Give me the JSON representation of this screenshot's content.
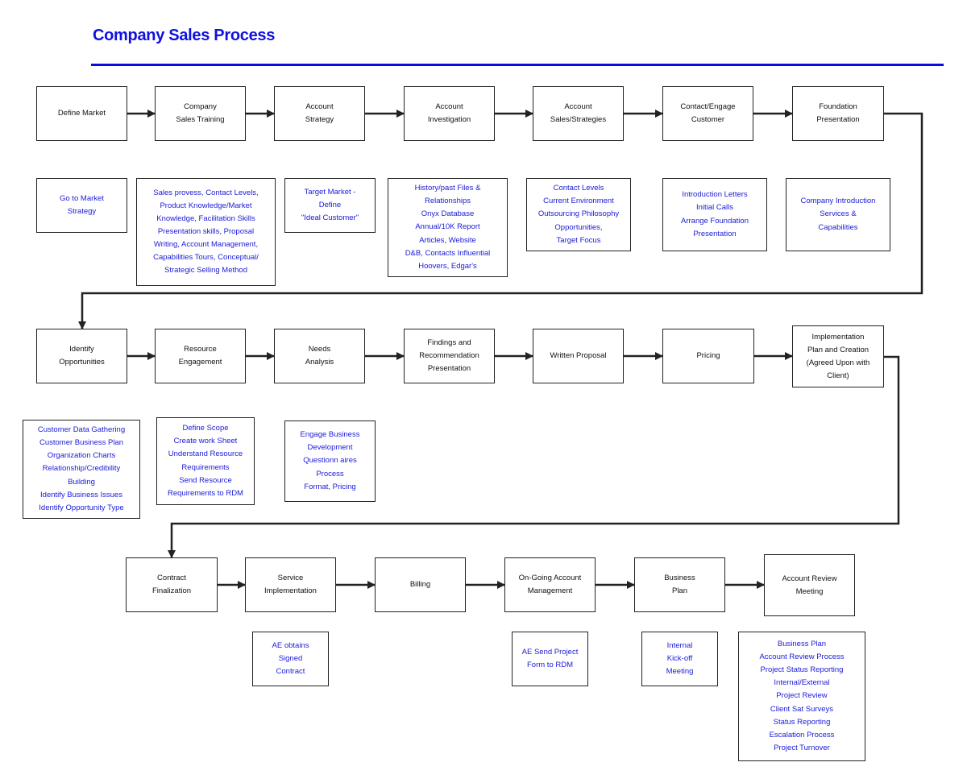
{
  "title": "Company Sales Process",
  "colors": {
    "title": "#1010e0",
    "note_text": "#1a1ad8",
    "step_text": "#111111",
    "connector": "#222222"
  },
  "row1": {
    "steps": [
      {
        "id": "define-market",
        "label": "Define Market"
      },
      {
        "id": "company-sales-training",
        "label": "Company\nSales Training"
      },
      {
        "id": "account-strategy",
        "label": "Account\nStrategy"
      },
      {
        "id": "account-investigation",
        "label": "Account\nInvestigation"
      },
      {
        "id": "account-sales-strategies",
        "label": "Account\nSales/Strategies"
      },
      {
        "id": "contact-engage-customer",
        "label": "Contact/Engage\nCustomer"
      },
      {
        "id": "foundation-presentation",
        "label": "Foundation\nPresentation"
      }
    ],
    "notes": [
      {
        "for": "define-market",
        "text": "Go to Market\nStrategy"
      },
      {
        "for": "company-sales-training",
        "text": "Sales provess, Contact Levels,\nProduct Knowledge/Market\nKnowledge, Facilitation Skills\nPresentation skills, Proposal\nWriting, Account Management,\nCapabilities Tours, Conceptual/\nStrategic Selling Method"
      },
      {
        "for": "account-strategy",
        "text": "Target Market -\nDefine\n\"Ideal Customer\""
      },
      {
        "for": "account-investigation",
        "text": "History/past Files &\nRelationships\nOnyx Database\nAnnual/10K Report\nArticles, Website\nD&B, Contacts Influential\nHoovers, Edgar's"
      },
      {
        "for": "account-sales-strategies",
        "text": "Contact Levels\nCurrent Environment\nOutsourcing Philosophy\nOpportunities,\nTarget Focus"
      },
      {
        "for": "contact-engage-customer",
        "text": "Introduction Letters\nInitial Calls\nArrange Foundation\nPresentation"
      },
      {
        "for": "foundation-presentation",
        "text": "Company Introduction\nServices &\nCapabilities"
      }
    ]
  },
  "row2": {
    "steps": [
      {
        "id": "identify-opportunities",
        "label": "Identify\nOpportunities"
      },
      {
        "id": "resource-engagement",
        "label": "Resource\nEngagement"
      },
      {
        "id": "needs-analysis",
        "label": "Needs\nAnalysis"
      },
      {
        "id": "findings-recommendation",
        "label": "Findings and\nRecommendation\nPresentation"
      },
      {
        "id": "written-proposal",
        "label": "Written Proposal"
      },
      {
        "id": "pricing",
        "label": "Pricing"
      },
      {
        "id": "implementation-plan",
        "label": "Implementation\nPlan and Creation\n(Agreed Upon with\nClient)"
      }
    ],
    "notes": [
      {
        "for": "identify-opportunities",
        "text": "Customer Data Gathering\nCustomer Business Plan\nOrganization Charts\nRelationship/Credibility\nBuilding\nIdentify Business Issues\nIdentify Opportunity Type"
      },
      {
        "for": "resource-engagement",
        "text": "Define Scope\nCreate work Sheet\nUnderstand Resource\nRequirements\nSend Resource\nRequirements to RDM"
      },
      {
        "for": "needs-analysis",
        "text": "Engage Business\nDevelopment\nQuestionn aires\nProcess\nFormat, Pricing"
      }
    ]
  },
  "row3": {
    "steps": [
      {
        "id": "contract-finalization",
        "label": "Contract\nFinalization"
      },
      {
        "id": "service-implementation",
        "label": "Service\nImplementation"
      },
      {
        "id": "billing",
        "label": "Billing"
      },
      {
        "id": "ongoing-account-management",
        "label": "On-Going Account\nManagement"
      },
      {
        "id": "business-plan",
        "label": "Business\nPlan"
      },
      {
        "id": "account-review-meeting",
        "label": "Account Review\nMeeting"
      }
    ],
    "notes": [
      {
        "for": "service-implementation",
        "text": "AE obtains\nSigned\nContract"
      },
      {
        "for": "ongoing-account-management",
        "text": "AE Send Project\nForm to RDM"
      },
      {
        "for": "business-plan",
        "text": "Internal\nKick-off\nMeeting"
      },
      {
        "for": "account-review-meeting",
        "text": "Business Plan\nAccount Review Process\nProject Status Reporting\nInternal/External\nProject Review\nClient Sat Surveys\nStatus Reporting\nEscalation Process\nProject Turnover"
      }
    ]
  }
}
